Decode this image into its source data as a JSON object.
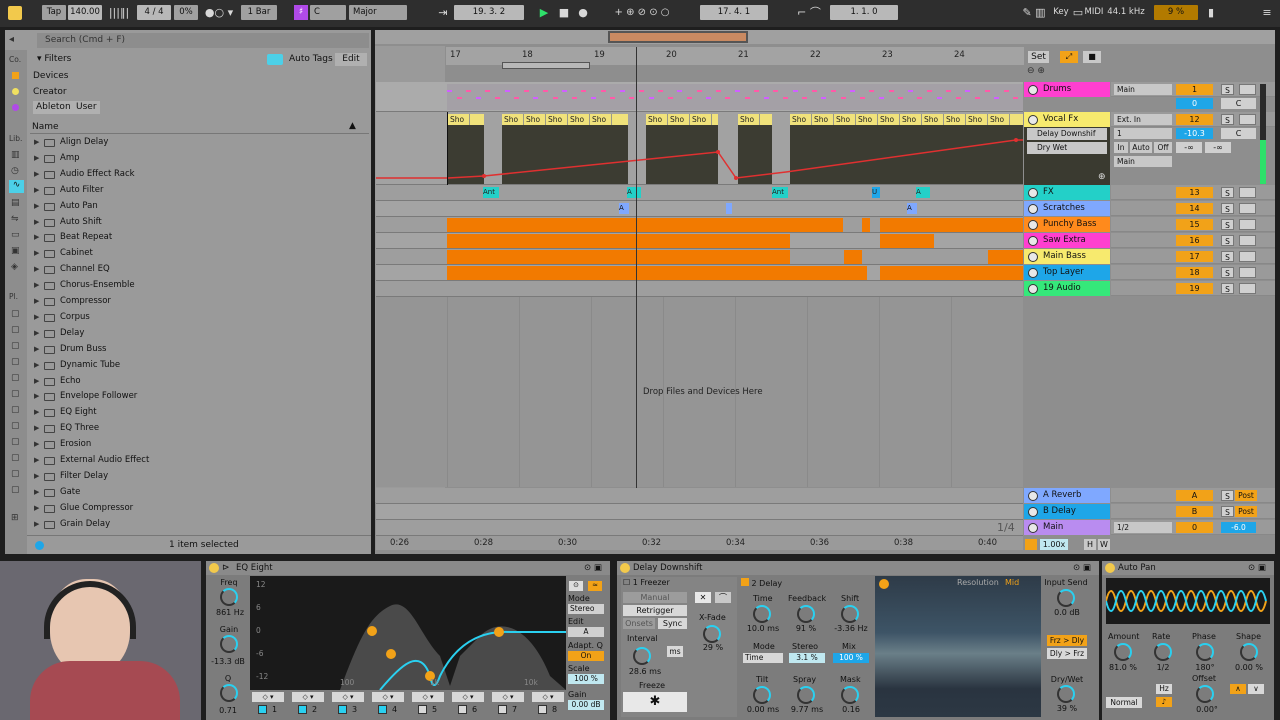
{
  "transport": {
    "tap": "Tap",
    "tempo": "140.00",
    "sig": "4 / 4",
    "groove": "0%",
    "quant": "1 Bar",
    "key": "C",
    "scale": "Major",
    "position": "19.   3.   2",
    "loop_start": "17.   4.   1",
    "loop_len": "1.   1.   0",
    "key_btn": "Key",
    "midi_btn": "MIDI",
    "sample_rate": "44.1 kHz",
    "cpu": "9 %"
  },
  "browser": {
    "search_placeholder": "Search (Cmd + F)",
    "filters": "Filters",
    "auto_tags": "Auto Tags",
    "edit": "Edit",
    "devices": "Devices",
    "creator": "Creator",
    "tag_ableton": "Ableton",
    "tag_user": "User",
    "name_header": "Name",
    "sidebar_co": "Co.",
    "sidebar_lib": "Lib.",
    "sidebar_pl": "Pl.",
    "items": [
      "Align Delay",
      "Amp",
      "Audio Effect Rack",
      "Auto Filter",
      "Auto Pan",
      "Auto Shift",
      "Beat Repeat",
      "Cabinet",
      "Channel EQ",
      "Chorus-Ensemble",
      "Compressor",
      "Corpus",
      "Delay",
      "Drum Buss",
      "Dynamic Tube",
      "Echo",
      "Envelope Follower",
      "EQ Eight",
      "EQ Three",
      "Erosion",
      "External Audio Effect",
      "Filter Delay",
      "Gate",
      "Glue Compressor",
      "Grain Delay"
    ],
    "status": "1 item selected"
  },
  "arrangement": {
    "bars": [
      "17",
      "18",
      "19",
      "20",
      "21",
      "22",
      "23",
      "24"
    ],
    "times": [
      "0:26",
      "0:28",
      "0:30",
      "0:32",
      "0:34",
      "0:36",
      "0:38",
      "0:40"
    ],
    "drop_text": "Drop Files and Devices Here",
    "set_label": "Set",
    "page_indicator": "1/4",
    "zoom": "1.00x",
    "btn_h": "H",
    "btn_w": "W",
    "clip_label": "Sho",
    "ant_label": "Ant",
    "a_label": "A",
    "u_label": "U"
  },
  "tracks": [
    {
      "name": "Drums",
      "color": "#ff3fd0",
      "num": "1",
      "routing": "Main"
    },
    {
      "name": "Vocal Fx",
      "color": "#f7ea6e",
      "num": "12",
      "routing": "Ext. In"
    },
    {
      "name": "FX",
      "color": "#23d0c8",
      "num": "13"
    },
    {
      "name": "Scratches",
      "color": "#7fa8ff",
      "num": "14"
    },
    {
      "name": "Punchy Bass",
      "color": "#ff8a1c",
      "num": "15"
    },
    {
      "name": "Saw Extra",
      "color": "#ff3fd0",
      "num": "16"
    },
    {
      "name": "Main Bass",
      "color": "#f7ea6e",
      "num": "17"
    },
    {
      "name": "Top Layer",
      "color": "#1ea6e8",
      "num": "18"
    },
    {
      "name": "19 Audio",
      "color": "#35e87a",
      "num": "19"
    }
  ],
  "returns": [
    {
      "name": "A Reverb",
      "color": "#7fa8ff",
      "letter": "A",
      "post": "Post"
    },
    {
      "name": "B Delay",
      "color": "#1ea6e8",
      "letter": "B",
      "post": "Post"
    },
    {
      "name": "Main",
      "color": "#b98cf0",
      "letter": "0",
      "routing": "1/2",
      "vol": "-6.0"
    }
  ],
  "vocal_fx": {
    "device": "Delay Downshif",
    "param": "Dry Wet",
    "monitor_in": "In",
    "monitor_auto": "Auto",
    "monitor_off": "Off",
    "input_ch": "1",
    "out": "Main",
    "vol": "-10.3",
    "pan": "C",
    "inf": "-∞"
  },
  "drums_ctrl": {
    "vol": "0",
    "pan": "C"
  },
  "eq": {
    "title": "EQ Eight",
    "freq_label": "Freq",
    "freq_val": "861 Hz",
    "gain_label": "Gain",
    "gain_val": "-13.3 dB",
    "q_label": "Q",
    "q_val": "0.71",
    "y_ticks": [
      "12",
      "6",
      "0",
      "-6",
      "-12"
    ],
    "x_ticks": [
      "100",
      "1k",
      "10k"
    ],
    "mode_label": "Mode",
    "mode_val": "Stereo",
    "edit_label": "Edit",
    "edit_val": "A",
    "adapt_label": "Adapt. Q",
    "adapt_val": "On",
    "scale_label": "Scale",
    "scale_val": "100 %",
    "out_gain_label": "Gain",
    "out_gain_val": "0.00 dB",
    "bands": [
      "1",
      "2",
      "3",
      "4",
      "5",
      "6",
      "7",
      "8"
    ]
  },
  "delay": {
    "title": "Delay Downshift",
    "freezer": "1 Freezer",
    "manual": "Manual",
    "retrigger": "Retrigger",
    "onsets": "Onsets",
    "sync": "Sync",
    "interval_label": "Interval",
    "interval_val": "28.6 ms",
    "ms": "ms",
    "freeze": "Freeze",
    "freeze_sym": "✱",
    "xfade_label": "X-Fade",
    "xfade_val": "29 %",
    "delay2": "2 Delay",
    "time_label": "Time",
    "time_val": "10.0 ms",
    "feedback_label": "Feedback",
    "feedback_val": "91 %",
    "shift_label": "Shift",
    "shift_val": "-3.36 Hz",
    "mode_label": "Mode",
    "mode_val": "Time",
    "stereo_label": "Stereo",
    "stereo_val": "3.1 %",
    "mix_label": "Mix",
    "mix_val": "100 %",
    "tilt_label": "Tilt",
    "tilt_val": "0.00 ms",
    "spray_label": "Spray",
    "spray_val": "9.77 ms",
    "mask_label": "Mask",
    "mask_val": "0.16",
    "resolution_label": "Resolution",
    "resolution_val": "Mid",
    "input_send_label": "Input Send",
    "input_send_val": "0.0 dB",
    "frz_dly": "Frz > Dly",
    "dly_frz": "Dly > Frz",
    "drywet_label": "Dry/Wet",
    "drywet_val": "39 %"
  },
  "autopan": {
    "title": "Auto Pan",
    "amount_label": "Amount",
    "amount_val": "81.0 %",
    "rate_label": "Rate",
    "rate_val": "1/2",
    "phase_label": "Phase",
    "phase_val": "180°",
    "shape_label": "Shape",
    "shape_val": "0.00 %",
    "offset_label": "Offset",
    "offset_val": "0.00°",
    "mode_val": "Normal",
    "hz": "Hz"
  }
}
